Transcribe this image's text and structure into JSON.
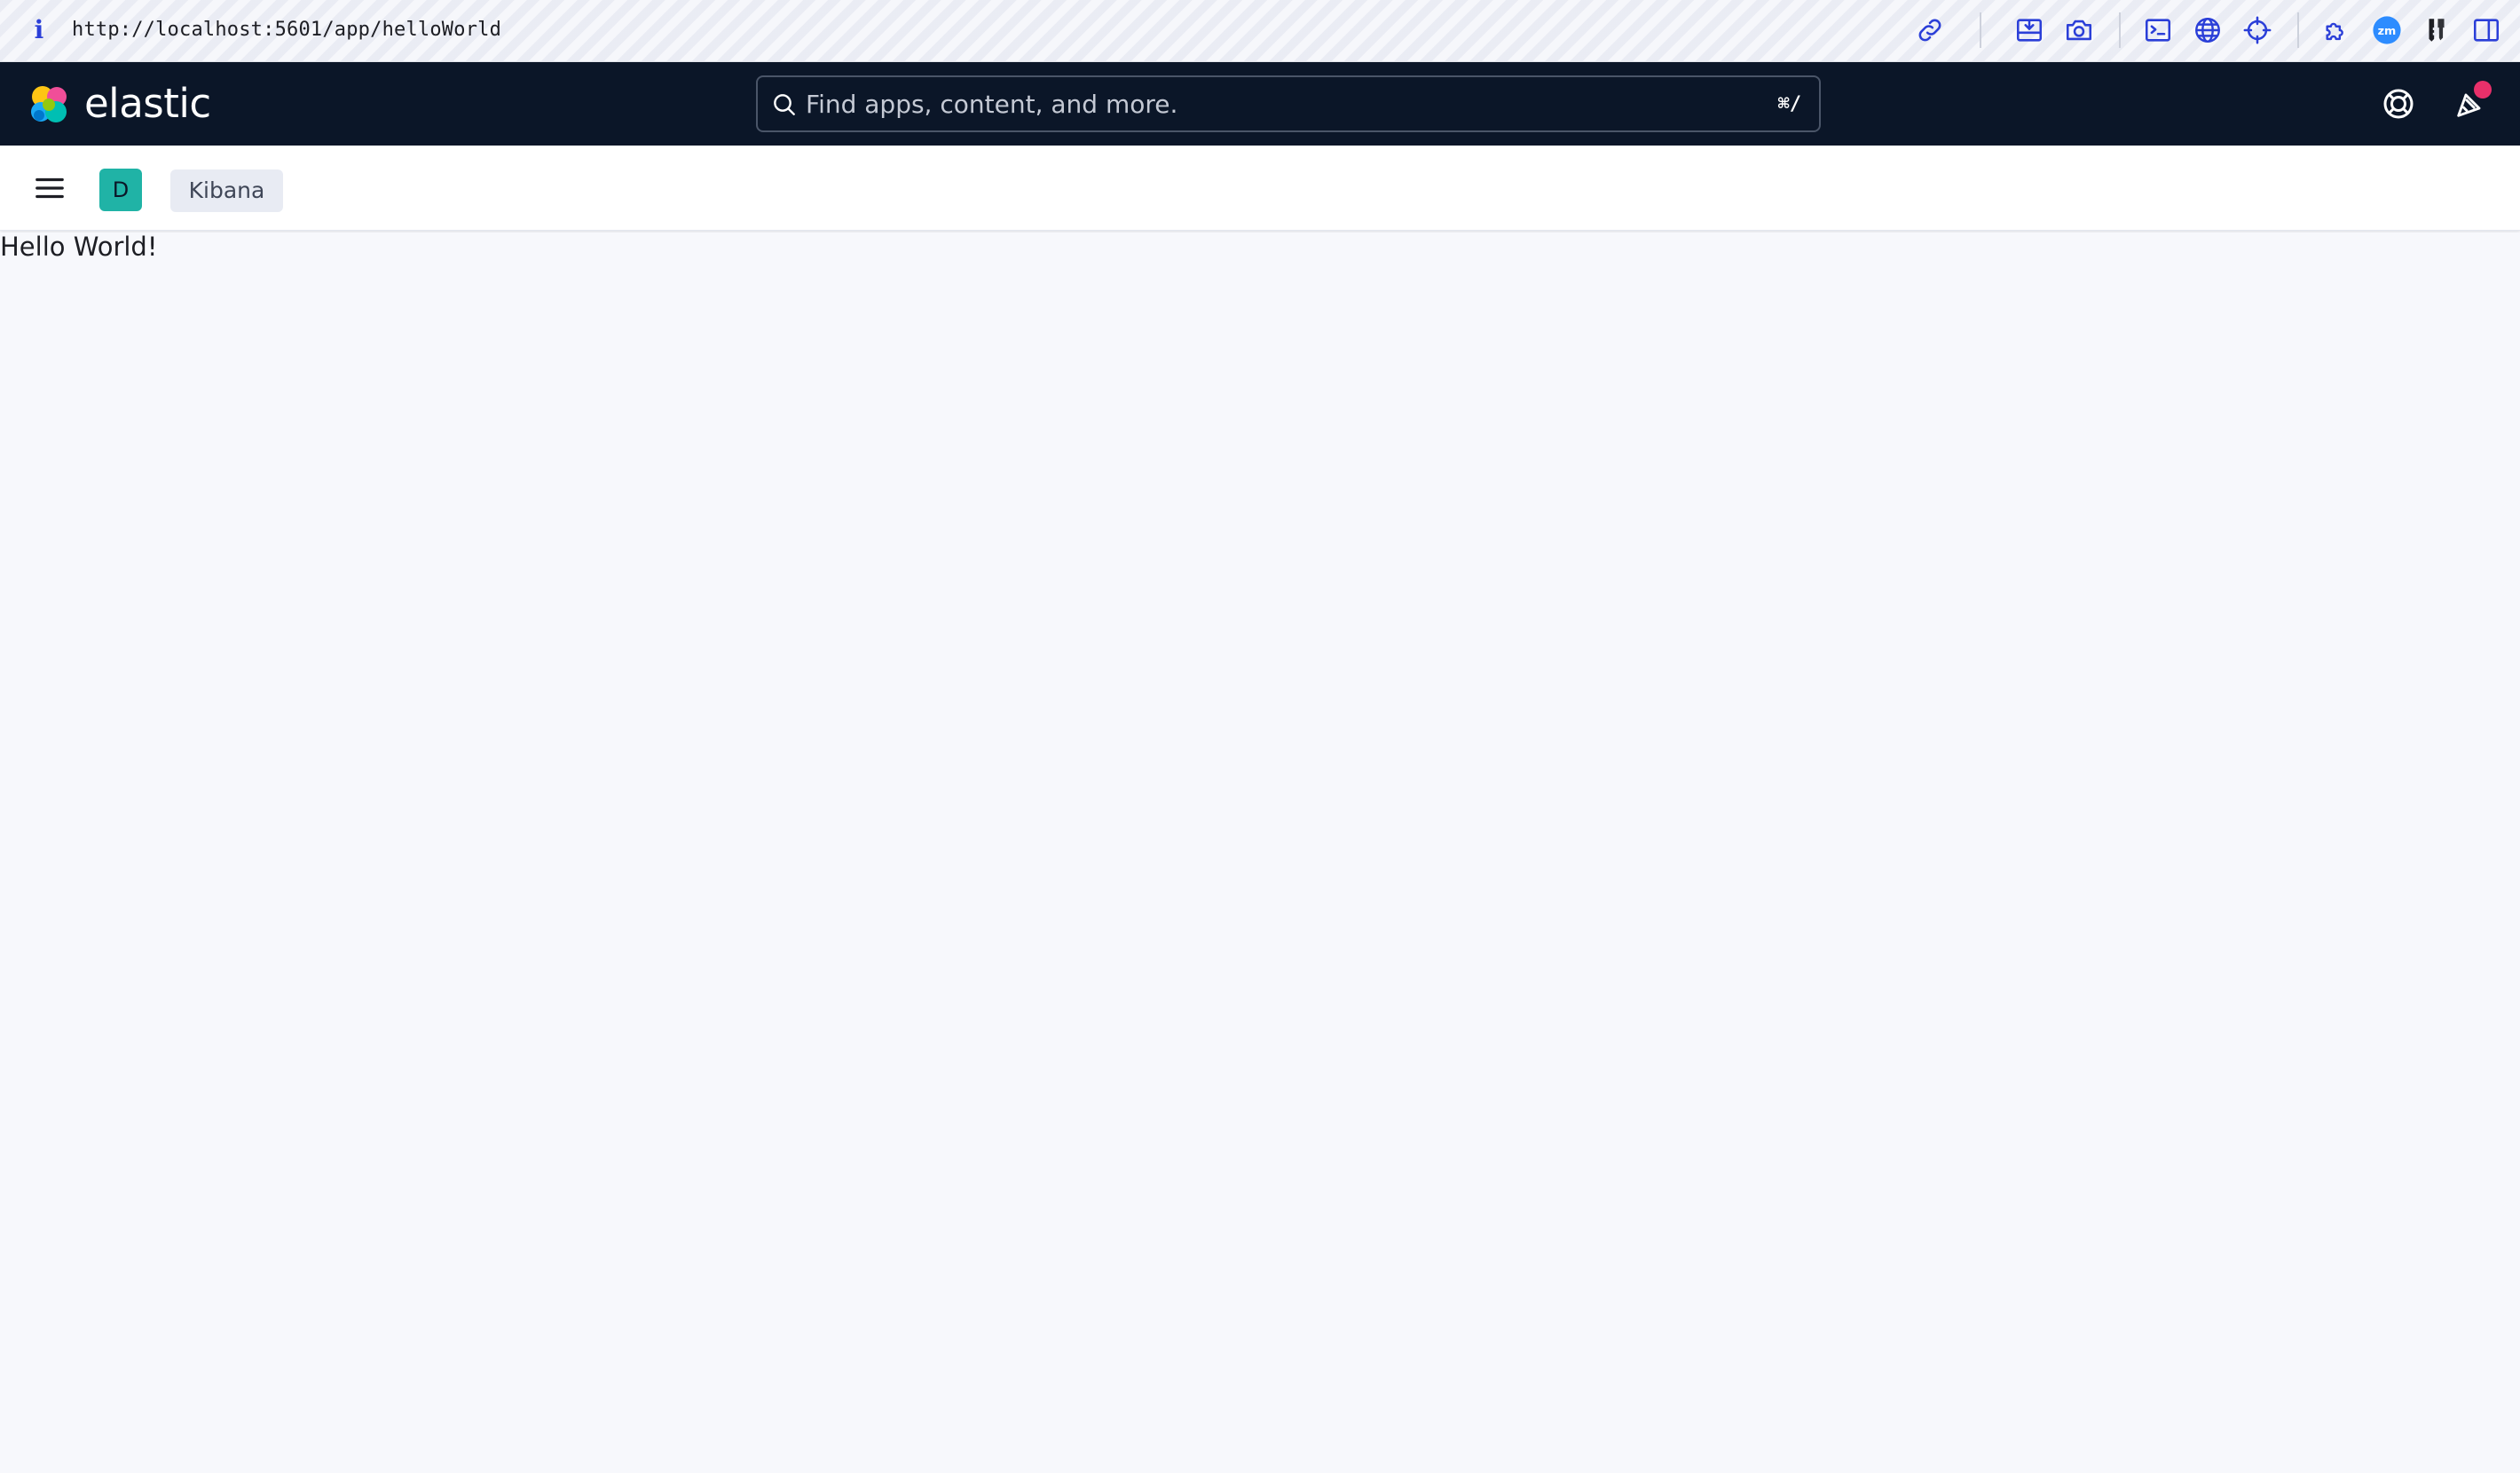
{
  "browser": {
    "url": "http://localhost:5601/app/helloWorld",
    "info_glyph": "i",
    "extension_icons": [
      "link-icon",
      "download-icon",
      "camera-icon",
      "terminal-icon",
      "globe-icon",
      "crosshair-icon",
      "extensions-icon",
      "zoom-icon",
      "key-icon",
      "sidebar-icon"
    ],
    "zoom_badge": "zm",
    "accent": "#2b3fd8"
  },
  "header": {
    "brand": "elastic",
    "search_placeholder": "Find apps, content, and more.",
    "search_shortcut": "⌘/",
    "background": "#0b1628",
    "notification_dot_color": "#e8306a"
  },
  "subnav": {
    "space_initial": "D",
    "space_color": "#20b3a6",
    "breadcrumb": "Kibana"
  },
  "content": {
    "text": "Hello World!"
  }
}
